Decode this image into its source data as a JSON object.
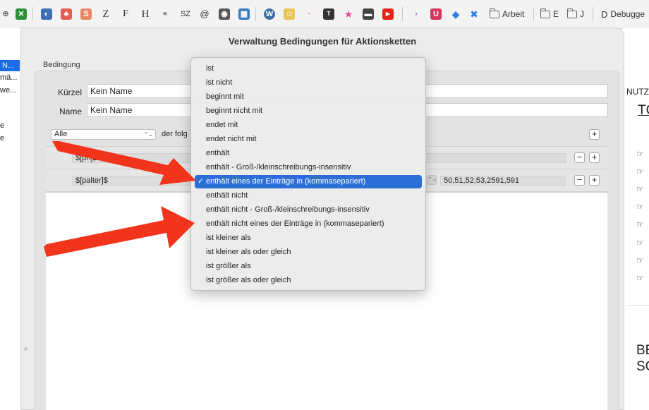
{
  "bookmarks": {
    "folders": [
      "Arbeit",
      "E",
      "J"
    ],
    "debugger_label": "Debugge"
  },
  "sheet": {
    "title": "Verwaltung Bedingungen für Aktionsketten",
    "group_label": "Bedingung",
    "kuerzel_label": "Kürzel",
    "kuerzel_value": "Kein Name",
    "name_label": "Name",
    "name_value": "Kein Name",
    "match_popup": "Alle",
    "match_suffix": "der folg",
    "rows": [
      {
        "variable": "$[ph]$",
        "value": ""
      },
      {
        "variable": "$[palter]$",
        "value": "50,51,52,53,2591,591"
      }
    ]
  },
  "left_sliver": {
    "selected": "N...",
    "lines": [
      "mä...",
      "we...",
      "e",
      "e"
    ]
  },
  "right_page": {
    "nutz": "NUTZ",
    "tc": "TC",
    "be": "BE",
    "sc": "SC"
  },
  "menu": {
    "selected_index": 8,
    "items": [
      "ist",
      "ist nicht",
      "beginnt mit",
      "beginnt nicht mit",
      "endet mit",
      "endet nicht mit",
      "enthält",
      "enthält - Groß-/kleinschreibungs-insensitiv",
      "enthält eines der Einträge in (kommasepariert)",
      "enthält nicht",
      "enthält nicht - Groß-/kleinschreibungs-insensitiv",
      "enthält nicht eines der Einträge in (kommasepariert)",
      "ist kleiner als",
      "ist kleiner als oder gleich",
      "ist größer als",
      "ist größer als oder gleich"
    ]
  },
  "colors": {
    "selection": "#2b6fd6",
    "arrow": "#f2341c"
  }
}
